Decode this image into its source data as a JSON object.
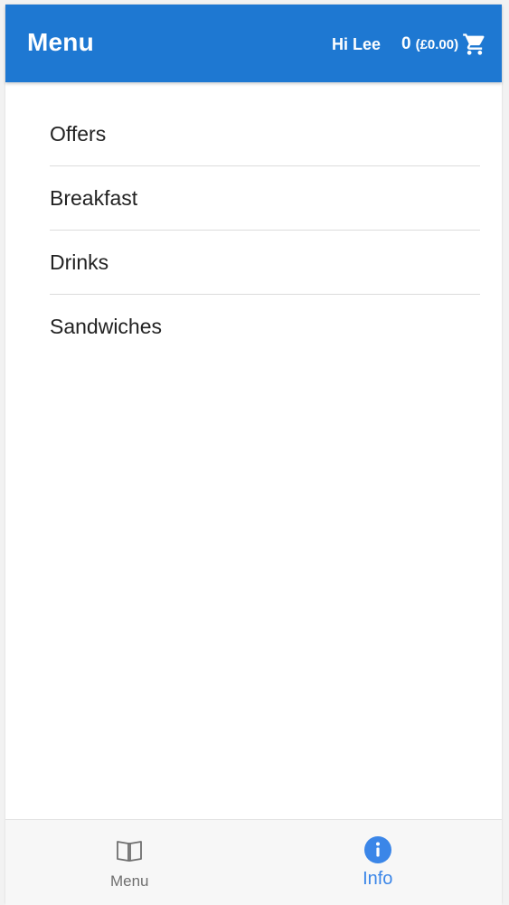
{
  "header": {
    "title": "Menu",
    "greeting": "Hi Lee",
    "cart": {
      "count": "0",
      "total": "(£0.00)",
      "icon": "cart-icon"
    }
  },
  "categories": [
    {
      "label": "Offers"
    },
    {
      "label": "Breakfast"
    },
    {
      "label": "Drinks"
    },
    {
      "label": "Sandwiches"
    }
  ],
  "bottom_nav": {
    "tabs": [
      {
        "label": "Menu",
        "icon": "book-icon",
        "active": false
      },
      {
        "label": "Info",
        "icon": "info-icon",
        "active": true
      }
    ]
  },
  "colors": {
    "header": "#1e78d2",
    "active_tab": "#3b86e8",
    "inactive_tab": "#6f6f6f"
  }
}
